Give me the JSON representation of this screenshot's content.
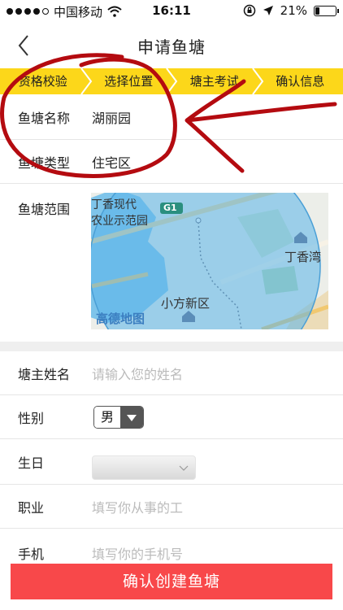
{
  "status_bar": {
    "carrier": "中国移动",
    "time": "16:11",
    "battery_text": "21%",
    "battery_level": 0.21
  },
  "nav": {
    "title": "申请鱼塘"
  },
  "steps": [
    {
      "label": "资格校验"
    },
    {
      "label": "选择位置"
    },
    {
      "label": "塘主考试"
    },
    {
      "label": "确认信息"
    }
  ],
  "pond": {
    "name_label": "鱼塘名称",
    "name_value": "湖丽园",
    "type_label": "鱼塘类型",
    "type_value": "住宅区",
    "range_label": "鱼塘范围"
  },
  "map": {
    "labels": {
      "top_left": "丁香现代",
      "top_left_2": "农业示范园",
      "road_badge": "G1",
      "right": "丁香湾",
      "bottom": "小方新区",
      "watermark": "高德地图"
    }
  },
  "owner": {
    "name_label": "塘主姓名",
    "name_placeholder": "请输入您的姓名",
    "gender_label": "性别",
    "gender_value": "男",
    "birthday_label": "生日",
    "job_label": "职业",
    "job_placeholder": "填写你从事的工",
    "phone_label": "手机",
    "phone_placeholder": "填写你的手机号"
  },
  "footer": {
    "confirm_label": "确认创建鱼塘"
  },
  "colors": {
    "accent_yellow": "#fcd71a",
    "confirm_red": "#f8484a",
    "map_water": "#7cc3ec",
    "annotation_red": "#b40b10"
  }
}
